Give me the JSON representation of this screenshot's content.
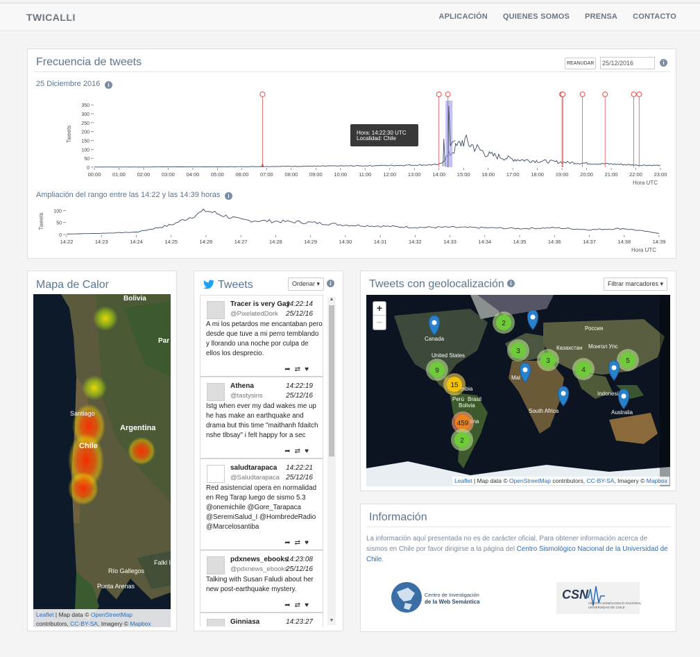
{
  "nav": {
    "brand": "TWICALLI",
    "links": [
      "APLICACIÓN",
      "QUIENES SOMOS",
      "PRENSA",
      "CONTACTO"
    ]
  },
  "freq": {
    "title": "Frecuencia de tweets",
    "date_heading": "25 Diciembre 2016",
    "resume_button": "REANUDAR",
    "date_input": "25/12/2016",
    "ylabel": "Tweets",
    "xlabel": "Hora UTC",
    "zoom_title": "Ampliación del rango entre las 14:22 y las 14:39 horas",
    "tooltip_time": "Hora: 14:22:30 UTC",
    "tooltip_place": "Localidad: Chile"
  },
  "chart_data": [
    {
      "type": "line",
      "title": "Frecuencia de tweets",
      "ylabel": "Tweets",
      "xlabel": "Hora UTC",
      "x": [
        "00:00",
        "01:00",
        "02:00",
        "03:00",
        "04:00",
        "05:00",
        "06:00",
        "07:00",
        "08:00",
        "09:00",
        "10:00",
        "11:00",
        "12:00",
        "13:00",
        "14:00",
        "15:00",
        "16:00",
        "17:00",
        "18:00",
        "19:00",
        "20:00",
        "21:00",
        "22:00",
        "23:00"
      ],
      "yticks": [
        0,
        50,
        100,
        150,
        200,
        250,
        300,
        350
      ],
      "ylim": [
        0,
        370
      ],
      "values": [
        1,
        1,
        1,
        2,
        2,
        2,
        3,
        4,
        5,
        6,
        7,
        8,
        10,
        12,
        14,
        150,
        70,
        45,
        35,
        28,
        22,
        18,
        12,
        10
      ],
      "events": [
        "06:50",
        "14:00",
        "14:22",
        "19:00",
        "19:02",
        "19:50",
        "20:45",
        "21:55",
        "22:08"
      ]
    },
    {
      "type": "line",
      "title": "Ampliación del rango entre las 14:22 y las 14:39 horas",
      "ylabel": "Tweets",
      "xlabel": "Hora UTC",
      "x": [
        "14:22",
        "14:23",
        "14:24",
        "14:25",
        "14:26",
        "14:27",
        "14:28",
        "14:29",
        "14:30",
        "14:31",
        "14:32",
        "14:33",
        "14:34",
        "14:35",
        "14:36",
        "14:37",
        "14:38",
        "14:39"
      ],
      "yticks": [
        0,
        50,
        100
      ],
      "ylim": [
        0,
        110
      ],
      "values": [
        2,
        5,
        10,
        40,
        100,
        60,
        55,
        50,
        40,
        35,
        30,
        30,
        28,
        25,
        28,
        20,
        25,
        5
      ]
    }
  ],
  "heat": {
    "title": "Mapa de Calor",
    "labels": [
      "Bolivia",
      "Par",
      "Santiago",
      "Chile",
      "Argentina",
      "Río Gallegos",
      "Punta Arenas",
      "Falkl Isla Malvi"
    ],
    "attrib_leaflet": "Leaflet",
    "attrib_text1": " | Map data © ",
    "attrib_osm": "OpenStreetMap",
    "attrib_text2": "contributors, ",
    "attrib_cc": "CC-BY-SA",
    "attrib_text3": ", Imagery © ",
    "attrib_mapbox": "Mapbox"
  },
  "tweets": {
    "title": "Tweets",
    "sort_button": "Ordenar",
    "items": [
      {
        "name": "Tracer is very Gay",
        "handle": "@PixelatedDork",
        "time": "14:22:14",
        "date": "25/12/16",
        "text": "A mi los petardos me encantaban pero desde que tuve a mi perro temblando y llorando una noche por culpa de ellos los desprecio."
      },
      {
        "name": "Athena",
        "handle": "@tastysins",
        "time": "14:22:19",
        "date": "25/12/16",
        "text": "Istg when ever my dad wakes me up he has make an earthquake and drama but this time \"maithanh fdaitch nshe tlbsay\" i felt happy for a sec"
      },
      {
        "name": "saludtarapaca",
        "handle": "@Saludtarapaca",
        "time": "14:22:21",
        "date": "25/12/16",
        "text": "Red asistencial opera en normalidad en Reg Tarap luego de sismo 5.3 @onemichile @Gore_Tarapaca @SeremiSalud_I @HombredeRadio @Marcelosantiba"
      },
      {
        "name": "pdxnews_ebooks",
        "handle": "@pdxnews_ebooks",
        "time": "14:23:08",
        "date": "25/12/16",
        "text": "Talking with Susan Faludi about her new post-earthquake mystery."
      },
      {
        "name": "Ginniasa",
        "handle": "",
        "time": "14:23:27",
        "date": "",
        "text": ""
      }
    ]
  },
  "geo": {
    "title": "Tweets con geolocalización",
    "filter_button": "Filtrar marcadores",
    "zoom_in": "+",
    "zoom_out": "−",
    "labels": [
      "Canada",
      "United States",
      "Россия",
      "Казахстан",
      "Монгол Улс",
      "Perú",
      "Brasil",
      "Bolivia",
      "South Africa",
      "Indonesia",
      "Australia",
      "mbia",
      "Mal",
      "ntina"
    ],
    "clusters": [
      "2",
      "3",
      "3",
      "4",
      "5",
      "9",
      "15",
      "459",
      "2"
    ],
    "attrib_leaflet": "Leaflet",
    "attrib_text1": " | Map data © ",
    "attrib_osm": "OpenStreetMap",
    "attrib_text2": " contributors, ",
    "attrib_cc": "CC-BY-SA",
    "attrib_text3": ", Imagery © ",
    "attrib_mapbox": "Mapbox"
  },
  "infobox": {
    "title": "Información",
    "text": "La información aquí presentada no es de carácter oficial. Para obtener información acerca de sismos en Chile por favor dirigirse a la página del ",
    "link": "Centro Sismológico Nacional de la Universidad de Chile",
    "end": ".",
    "logo1_l1": "Centro de Investigación",
    "logo1_l2": "de la Web Semántica",
    "logo2_l1": "CSN",
    "logo2_l2": "CENTRO SISMOLOGICO NACIONAL",
    "logo2_l3": "UNIVERSIDAD DE CHILE"
  },
  "colors": {
    "accent": "#5a7590",
    "link": "#2a6cb5",
    "event": "#e05050",
    "twitter": "#1da1f2",
    "pin": "#2a81cb"
  }
}
